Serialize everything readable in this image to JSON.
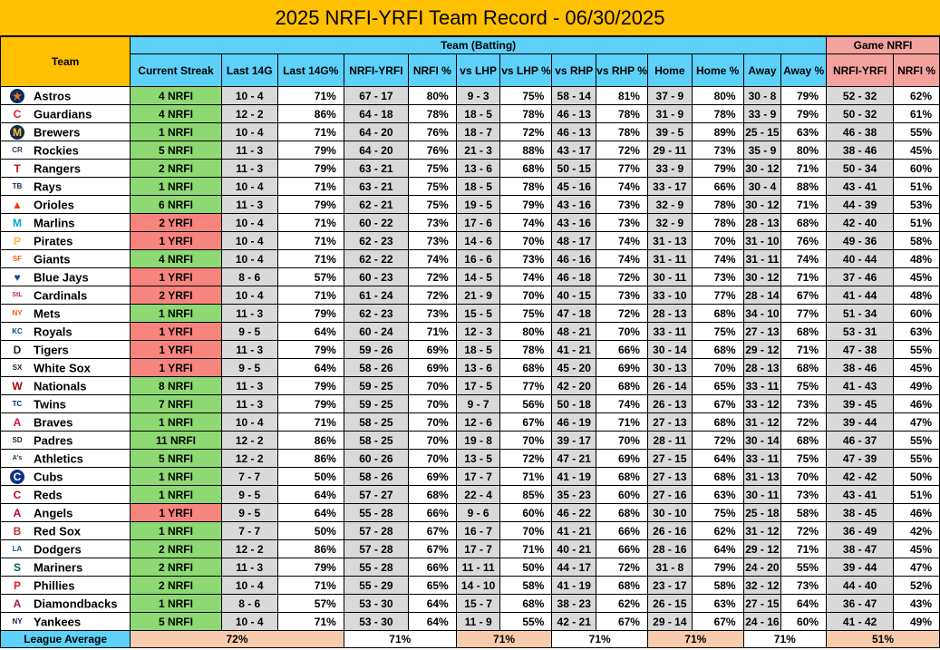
{
  "title": "2025 NRFI-YRFI Team Record - 06/30/2025",
  "headers": {
    "team": "Team",
    "group_batting": "Team (Batting)",
    "group_game": "Game NRFI",
    "columns": [
      "Current Streak",
      "Last 14G",
      "Last 14G%",
      "NRFI-YRFI",
      "NRFI %",
      "vs LHP",
      "vs LHP %",
      "vs RHP",
      "vs RHP %",
      "Home",
      "Home %",
      "Away",
      "Away %",
      "NRFI-YRFI",
      "NRFI %"
    ]
  },
  "colors": {
    "title_bg": "#FFC000",
    "batting_header": "#5DD1F9",
    "game_header": "#F4A29E",
    "streak_nrfi": "#8ED973",
    "streak_yrfi": "#F8847E",
    "shaded": "#D9D9D9"
  },
  "rows": [
    {
      "team": "Astros",
      "icon": "astros-logo",
      "streak": "4 NRFI",
      "streak_type": "nrfi",
      "vals": [
        "10 - 4",
        "71%",
        "67 - 17",
        "80%",
        "9 - 3",
        "75%",
        "58 - 14",
        "81%",
        "37 - 9",
        "80%",
        "30 - 8",
        "79%",
        "52 - 32",
        "62%"
      ]
    },
    {
      "team": "Guardians",
      "icon": "guardians-logo",
      "streak": "4 NRFI",
      "streak_type": "nrfi",
      "vals": [
        "12 - 2",
        "86%",
        "64 - 18",
        "78%",
        "18 - 5",
        "78%",
        "46 - 13",
        "78%",
        "31 - 9",
        "78%",
        "33 - 9",
        "79%",
        "50 - 32",
        "61%"
      ]
    },
    {
      "team": "Brewers",
      "icon": "brewers-logo",
      "streak": "1 NRFI",
      "streak_type": "nrfi",
      "vals": [
        "10 - 4",
        "71%",
        "64 - 20",
        "76%",
        "18 - 7",
        "72%",
        "46 - 13",
        "78%",
        "39 - 5",
        "89%",
        "25 - 15",
        "63%",
        "46 - 38",
        "55%"
      ]
    },
    {
      "team": "Rockies",
      "icon": "rockies-logo",
      "streak": "5 NRFI",
      "streak_type": "nrfi",
      "vals": [
        "11 - 3",
        "79%",
        "64 - 20",
        "76%",
        "21 - 3",
        "88%",
        "43 - 17",
        "72%",
        "29 - 11",
        "73%",
        "35 - 9",
        "80%",
        "38 - 46",
        "45%"
      ]
    },
    {
      "team": "Rangers",
      "icon": "rangers-logo",
      "streak": "2 NRFI",
      "streak_type": "nrfi",
      "vals": [
        "11 - 3",
        "79%",
        "63 - 21",
        "75%",
        "13 - 6",
        "68%",
        "50 - 15",
        "77%",
        "33 - 9",
        "79%",
        "30 - 12",
        "71%",
        "50 - 34",
        "60%"
      ]
    },
    {
      "team": "Rays",
      "icon": "rays-logo",
      "streak": "1 NRFI",
      "streak_type": "nrfi",
      "vals": [
        "10 - 4",
        "71%",
        "63 - 21",
        "75%",
        "18 - 5",
        "78%",
        "45 - 16",
        "74%",
        "33 - 17",
        "66%",
        "30 - 4",
        "88%",
        "43 - 41",
        "51%"
      ]
    },
    {
      "team": "Orioles",
      "icon": "orioles-logo",
      "streak": "6 NRFI",
      "streak_type": "nrfi",
      "vals": [
        "11 - 3",
        "79%",
        "62 - 21",
        "75%",
        "19 - 5",
        "79%",
        "43 - 16",
        "73%",
        "32 - 9",
        "78%",
        "30 - 12",
        "71%",
        "44 - 39",
        "53%"
      ]
    },
    {
      "team": "Marlins",
      "icon": "marlins-logo",
      "streak": "2 YRFI",
      "streak_type": "yrfi",
      "vals": [
        "10 - 4",
        "71%",
        "60 - 22",
        "73%",
        "17 - 6",
        "74%",
        "43 - 16",
        "73%",
        "32 - 9",
        "78%",
        "28 - 13",
        "68%",
        "42 - 40",
        "51%"
      ]
    },
    {
      "team": "Pirates",
      "icon": "pirates-logo",
      "streak": "1 YRFI",
      "streak_type": "yrfi",
      "vals": [
        "10 - 4",
        "71%",
        "62 - 23",
        "73%",
        "14 - 6",
        "70%",
        "48 - 17",
        "74%",
        "31 - 13",
        "70%",
        "31 - 10",
        "76%",
        "49 - 36",
        "58%"
      ]
    },
    {
      "team": "Giants",
      "icon": "giants-logo",
      "streak": "4 NRFI",
      "streak_type": "nrfi",
      "vals": [
        "10 - 4",
        "71%",
        "62 - 22",
        "74%",
        "16 - 6",
        "73%",
        "46 - 16",
        "74%",
        "31 - 11",
        "74%",
        "31 - 11",
        "74%",
        "40 - 44",
        "48%"
      ]
    },
    {
      "team": "Blue Jays",
      "icon": "blue-jays-logo",
      "streak": "1 YRFI",
      "streak_type": "yrfi",
      "vals": [
        "8 - 6",
        "57%",
        "60 - 23",
        "72%",
        "14 - 5",
        "74%",
        "46 - 18",
        "72%",
        "30 - 11",
        "73%",
        "30 - 12",
        "71%",
        "37 - 46",
        "45%"
      ]
    },
    {
      "team": "Cardinals",
      "icon": "cardinals-logo",
      "streak": "2 YRFI",
      "streak_type": "yrfi",
      "vals": [
        "10 - 4",
        "71%",
        "61 - 24",
        "72%",
        "21 - 9",
        "70%",
        "40 - 15",
        "73%",
        "33 - 10",
        "77%",
        "28 - 14",
        "67%",
        "41 - 44",
        "48%"
      ]
    },
    {
      "team": "Mets",
      "icon": "mets-logo",
      "streak": "1 NRFI",
      "streak_type": "nrfi",
      "vals": [
        "11 - 3",
        "79%",
        "62 - 23",
        "73%",
        "15 - 5",
        "75%",
        "47 - 18",
        "72%",
        "28 - 13",
        "68%",
        "34 - 10",
        "77%",
        "51 - 34",
        "60%"
      ]
    },
    {
      "team": "Royals",
      "icon": "royals-logo",
      "streak": "1 YRFI",
      "streak_type": "yrfi",
      "vals": [
        "9 - 5",
        "64%",
        "60 - 24",
        "71%",
        "12 - 3",
        "80%",
        "48 - 21",
        "70%",
        "33 - 11",
        "75%",
        "27 - 13",
        "68%",
        "53 - 31",
        "63%"
      ]
    },
    {
      "team": "Tigers",
      "icon": "tigers-logo",
      "streak": "1 YRFI",
      "streak_type": "yrfi",
      "vals": [
        "11 - 3",
        "79%",
        "59 - 26",
        "69%",
        "18 - 5",
        "78%",
        "41 - 21",
        "66%",
        "30 - 14",
        "68%",
        "29 - 12",
        "71%",
        "47 - 38",
        "55%"
      ]
    },
    {
      "team": "White Sox",
      "icon": "white-sox-logo",
      "streak": "1 YRFI",
      "streak_type": "yrfi",
      "vals": [
        "9 - 5",
        "64%",
        "58 - 26",
        "69%",
        "13 - 6",
        "68%",
        "45 - 20",
        "69%",
        "30 - 13",
        "70%",
        "28 - 13",
        "68%",
        "38 - 46",
        "45%"
      ]
    },
    {
      "team": "Nationals",
      "icon": "nationals-logo",
      "streak": "8 NRFI",
      "streak_type": "nrfi",
      "vals": [
        "11 - 3",
        "79%",
        "59 - 25",
        "70%",
        "17 - 5",
        "77%",
        "42 - 20",
        "68%",
        "26 - 14",
        "65%",
        "33 - 11",
        "75%",
        "41 - 43",
        "49%"
      ]
    },
    {
      "team": "Twins",
      "icon": "twins-logo",
      "streak": "7 NRFI",
      "streak_type": "nrfi",
      "vals": [
        "11 - 3",
        "79%",
        "59 - 25",
        "70%",
        "9 - 7",
        "56%",
        "50 - 18",
        "74%",
        "26 - 13",
        "67%",
        "33 - 12",
        "73%",
        "39 - 45",
        "46%"
      ]
    },
    {
      "team": "Braves",
      "icon": "braves-logo",
      "streak": "1 NRFI",
      "streak_type": "nrfi",
      "vals": [
        "10 - 4",
        "71%",
        "58 - 25",
        "70%",
        "12 - 6",
        "67%",
        "46 - 19",
        "71%",
        "27 - 13",
        "68%",
        "31 - 12",
        "72%",
        "39 - 44",
        "47%"
      ]
    },
    {
      "team": "Padres",
      "icon": "padres-logo",
      "streak": "11 NRFI",
      "streak_type": "nrfi",
      "vals": [
        "12 - 2",
        "86%",
        "58 - 25",
        "70%",
        "19 - 8",
        "70%",
        "39 - 17",
        "70%",
        "28 - 11",
        "72%",
        "30 - 14",
        "68%",
        "46 - 37",
        "55%"
      ]
    },
    {
      "team": "Athletics",
      "icon": "athletics-logo",
      "streak": "5 NRFI",
      "streak_type": "nrfi",
      "vals": [
        "12 - 2",
        "86%",
        "60 - 26",
        "70%",
        "13 - 5",
        "72%",
        "47 - 21",
        "69%",
        "27 - 15",
        "64%",
        "33 - 11",
        "75%",
        "47 - 39",
        "55%"
      ]
    },
    {
      "team": "Cubs",
      "icon": "cubs-logo",
      "streak": "1 NRFI",
      "streak_type": "nrfi",
      "vals": [
        "7 - 7",
        "50%",
        "58 - 26",
        "69%",
        "17 - 7",
        "71%",
        "41 - 19",
        "68%",
        "27 - 13",
        "68%",
        "31 - 13",
        "70%",
        "42 - 42",
        "50%"
      ]
    },
    {
      "team": "Reds",
      "icon": "reds-logo",
      "streak": "1 NRFI",
      "streak_type": "nrfi",
      "vals": [
        "9 - 5",
        "64%",
        "57 - 27",
        "68%",
        "22 - 4",
        "85%",
        "35 - 23",
        "60%",
        "27 - 16",
        "63%",
        "30 - 11",
        "73%",
        "43 - 41",
        "51%"
      ]
    },
    {
      "team": "Angels",
      "icon": "angels-logo",
      "streak": "1 YRFI",
      "streak_type": "yrfi",
      "vals": [
        "9 - 5",
        "64%",
        "55 - 28",
        "66%",
        "9 - 6",
        "60%",
        "46 - 22",
        "68%",
        "30 - 10",
        "75%",
        "25 - 18",
        "58%",
        "38 - 45",
        "46%"
      ]
    },
    {
      "team": "Red Sox",
      "icon": "red-sox-logo",
      "streak": "1 NRFI",
      "streak_type": "nrfi",
      "vals": [
        "7 - 7",
        "50%",
        "57 - 28",
        "67%",
        "16 - 7",
        "70%",
        "41 - 21",
        "66%",
        "26 - 16",
        "62%",
        "31 - 12",
        "72%",
        "36 - 49",
        "42%"
      ]
    },
    {
      "team": "Dodgers",
      "icon": "dodgers-logo",
      "streak": "2 NRFI",
      "streak_type": "nrfi",
      "vals": [
        "12 - 2",
        "86%",
        "57 - 28",
        "67%",
        "17 - 7",
        "71%",
        "40 - 21",
        "66%",
        "28 - 16",
        "64%",
        "29 - 12",
        "71%",
        "38 - 47",
        "45%"
      ]
    },
    {
      "team": "Mariners",
      "icon": "mariners-logo",
      "streak": "2 NRFI",
      "streak_type": "nrfi",
      "vals": [
        "11 - 3",
        "79%",
        "55 - 28",
        "66%",
        "11 - 11",
        "50%",
        "44 - 17",
        "72%",
        "31 - 8",
        "79%",
        "24 - 20",
        "55%",
        "39 - 44",
        "47%"
      ]
    },
    {
      "team": "Phillies",
      "icon": "phillies-logo",
      "streak": "2 NRFI",
      "streak_type": "nrfi",
      "vals": [
        "10 - 4",
        "71%",
        "55 - 29",
        "65%",
        "14 - 10",
        "58%",
        "41 - 19",
        "68%",
        "23 - 17",
        "58%",
        "32 - 12",
        "73%",
        "44 - 40",
        "52%"
      ]
    },
    {
      "team": "Diamondbacks",
      "icon": "diamondbacks-logo",
      "streak": "1 NRFI",
      "streak_type": "nrfi",
      "vals": [
        "8 - 6",
        "57%",
        "53 - 30",
        "64%",
        "15 - 7",
        "68%",
        "38 - 23",
        "62%",
        "26 - 15",
        "63%",
        "27 - 15",
        "64%",
        "36 - 47",
        "43%"
      ]
    },
    {
      "team": "Yankees",
      "icon": "yankees-logo",
      "streak": "5 NRFI",
      "streak_type": "nrfi",
      "vals": [
        "10 - 4",
        "71%",
        "53 - 30",
        "64%",
        "11 - 9",
        "55%",
        "42 - 21",
        "67%",
        "29 - 14",
        "67%",
        "24 - 16",
        "60%",
        "41 - 42",
        "49%"
      ]
    }
  ],
  "footer": {
    "label": "League Average",
    "values": [
      "72%",
      "71%",
      "71%",
      "71%",
      "71%",
      "71%",
      "51%"
    ]
  }
}
